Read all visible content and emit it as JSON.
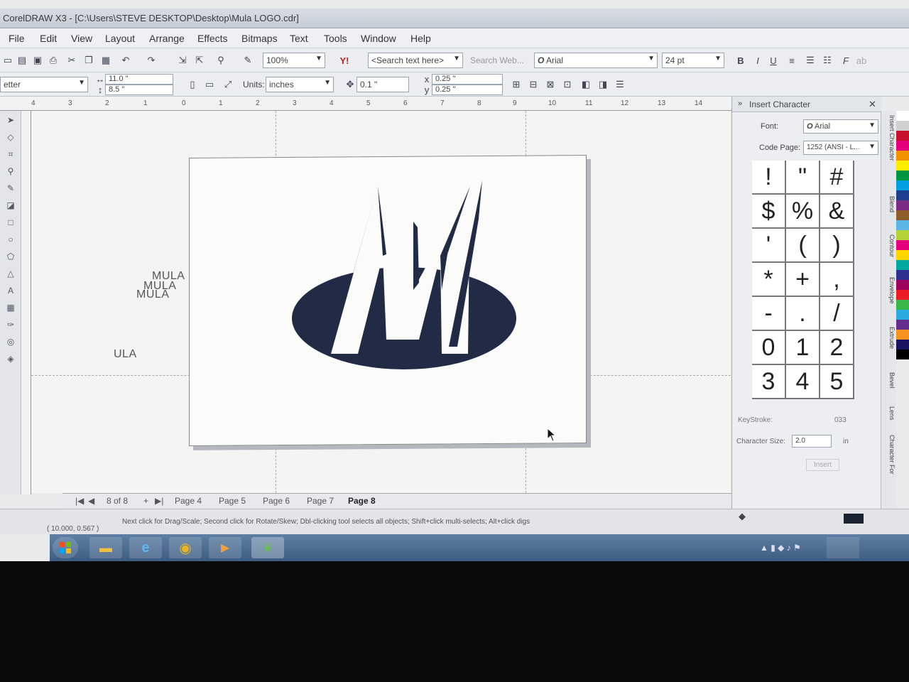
{
  "window": {
    "title": "CorelDRAW X3 - [C:\\Users\\STEVE DESKTOP\\Desktop\\Mula LOGO.cdr]"
  },
  "menu": [
    "File",
    "Edit",
    "View",
    "Layout",
    "Arrange",
    "Effects",
    "Bitmaps",
    "Text",
    "Tools",
    "Window",
    "Help"
  ],
  "toolbar1": {
    "zoom": "100%",
    "search_placeholder": "<Search text here>",
    "search_web": "Search Web...",
    "font": "Arial",
    "font_size": "24 pt"
  },
  "toolbar2": {
    "paper": "etter",
    "width": "11.0 \"",
    "height": "8.5 \"",
    "units_label": "Units:",
    "units": "inches",
    "nudge": "0.1 \"",
    "dup_x": "0.25 \"",
    "dup_y": "0.25 \""
  },
  "ruler": {
    "unit": "inches",
    "ticks": [
      "4",
      "3",
      "2",
      "1",
      "0",
      "1",
      "2",
      "3",
      "4",
      "5",
      "6",
      "7",
      "8",
      "9",
      "10",
      "11",
      "12",
      "13",
      "14"
    ]
  },
  "canvas": {
    "texts": [
      "MULA",
      "MULA",
      "MULA",
      "ULA"
    ]
  },
  "page_tabs": {
    "counter": "8 of 8",
    "tabs": [
      "Page 4",
      "Page 5",
      "Page 6",
      "Page 7",
      "Page 8"
    ],
    "active": "Page 8"
  },
  "status": {
    "coords": "( 10.000, 0.567 )",
    "hint": "Next click for Drag/Scale; Second click for Rotate/Skew; Dbl-clicking tool selects all objects; Shift+click multi-selects; Alt+click digs"
  },
  "docker": {
    "title": "Insert Character",
    "font_label": "Font:",
    "font": "Arial",
    "codepage_label": "Code Page:",
    "codepage": "1252 (ANSI - L...",
    "chars": [
      "!",
      "\"",
      "#",
      "$",
      "%",
      "&",
      "'",
      "(",
      ")",
      "*",
      "+",
      ",",
      "-",
      ".",
      "/",
      "0",
      "1",
      "2",
      "3",
      "4",
      "5"
    ],
    "keystroke_label": "KeyStroke:",
    "keystroke": "033",
    "charsize_label": "Character Size:",
    "charsize": "2.0",
    "charsize_unit": "in",
    "insert_button": "Insert"
  },
  "right_tabs": [
    "Insert Character",
    "Blend",
    "Contour",
    "Envelope",
    "Extrude",
    "Bevel",
    "Lens",
    "Character For"
  ],
  "colors": {
    "logo": "#222b45",
    "taskbar": "#4a6a90"
  }
}
